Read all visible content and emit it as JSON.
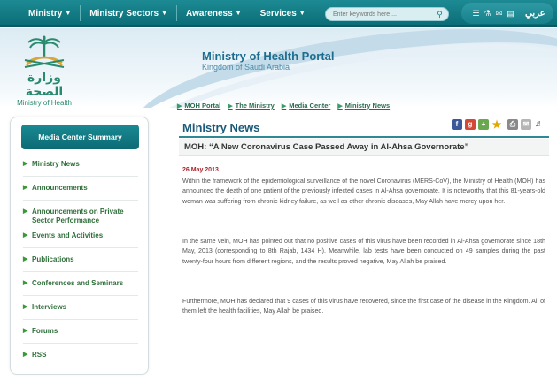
{
  "nav": {
    "items": [
      {
        "label": "Ministry"
      },
      {
        "label": "Ministry Sectors"
      },
      {
        "label": "Awareness"
      },
      {
        "label": "Services"
      }
    ],
    "search_placeholder": "Enter keywords here ...",
    "language_label": "عربي"
  },
  "logo": {
    "arabic_text": "وزارة الصحة",
    "english_text": "Ministry of Health"
  },
  "header": {
    "title": "Ministry of Health Portal",
    "subtitle": "Kingdom of Saudi Arabia"
  },
  "breadcrumb": [
    {
      "label": "MOH Portal"
    },
    {
      "label": "The Ministry"
    },
    {
      "label": "Media Center"
    },
    {
      "label": "Ministry News"
    }
  ],
  "sidebar": {
    "heading": "Media Center Summary",
    "items": [
      {
        "label": "Ministry News"
      },
      {
        "label": "Announcements"
      },
      {
        "label": "Announcements on Private Sector Performance"
      },
      {
        "label": "Events and Activities"
      },
      {
        "label": "Publications"
      },
      {
        "label": "Conferences and Seminars"
      },
      {
        "label": "Interviews"
      },
      {
        "label": "Forums"
      },
      {
        "label": "RSS"
      }
    ]
  },
  "content": {
    "section_title": "Ministry News",
    "headline": "MOH: “A New Coronavirus Case Passed Away in Al-Ahsa Governorate”",
    "date": "26 May 2013",
    "paragraphs": [
      "Within the framework of the epidemiological surveillance of the novel Coronavirus (MERS-CoV), the Ministry of Health (MOH) has announced the death of one patient of the previously infected cases in Al-Ahsa governorate. It is noteworthy that this 81-years-old woman was suffering from chronic kidney failure, as well as other chronic diseases, May Allah have mercy upon her.",
      "In the same vein, MOH has pointed out that no positive cases of this virus have been recorded in Al-Ahsa governorate since 18th May, 2013 (corresponding to 8th Rajab, 1434 H). Meanwhile, lab tests have been conducted on 49 samples during the past twenty-four hours from different regions, and the results proved negative, May Allah be praised.",
      "Furthermore, MOH has declared that 9 cases of this virus have recovered, since the first case of the disease in the Kingdom. All of them left the health facilities, May Allah be praised."
    ]
  },
  "colors": {
    "nav_bg": "#0b6d78",
    "accent_green": "#2f6f3a",
    "title_blue": "#1b5a7a",
    "date_red": "#b0202a"
  },
  "icons": {
    "share": [
      "facebook-icon",
      "google-plus-icon",
      "add-icon",
      "favorite-star-icon",
      "print-icon",
      "email-icon",
      "audio-icon"
    ],
    "tools": [
      "sitemap-icon",
      "accessibility-icon",
      "mail-icon",
      "text-size-icon"
    ]
  }
}
